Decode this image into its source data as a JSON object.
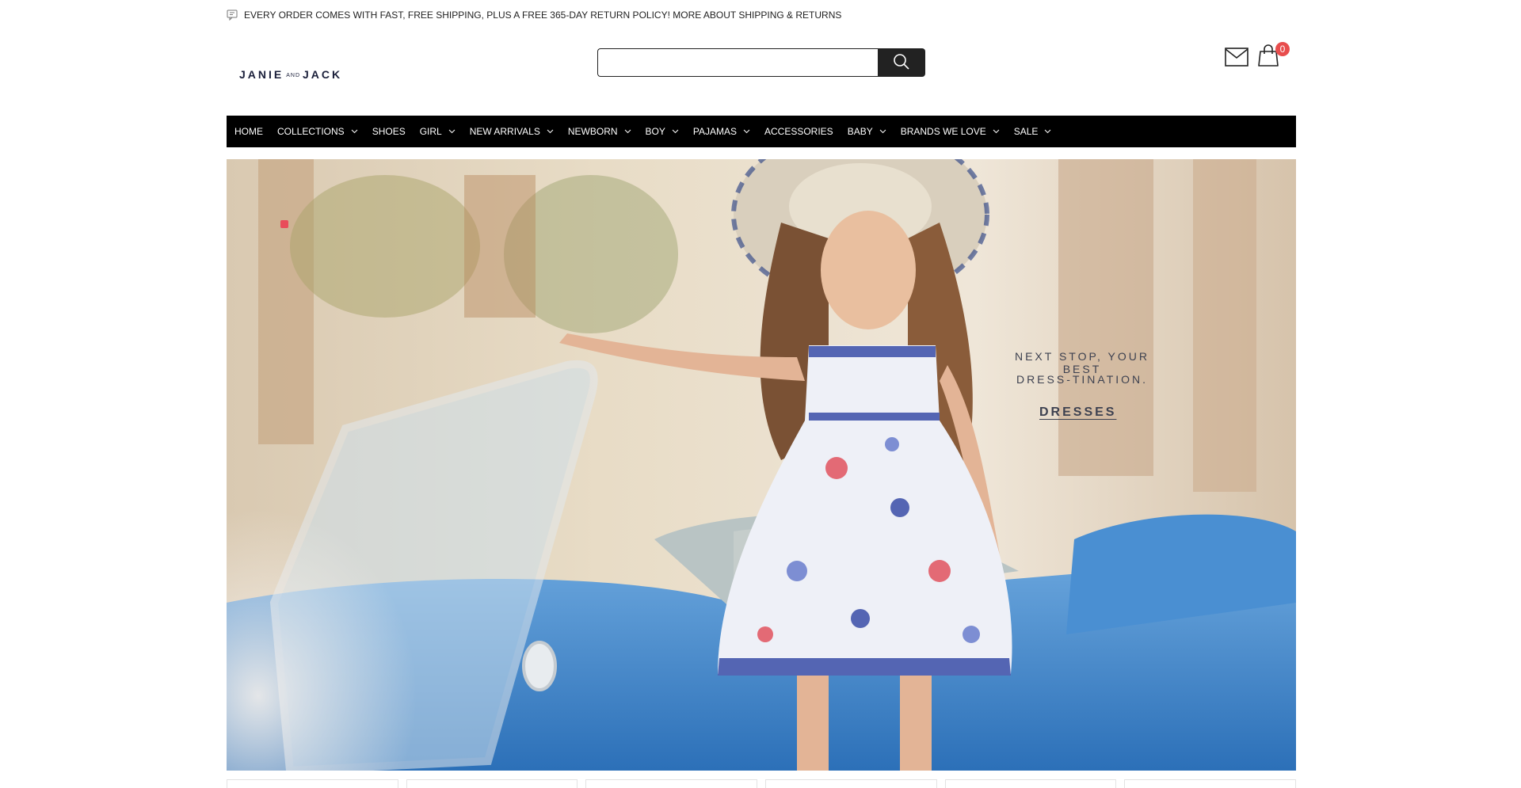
{
  "announcement": {
    "text": "EVERY ORDER COMES WITH FAST, FREE SHIPPING, PLUS A FREE 365-DAY RETURN POLICY! MORE ABOUT SHIPPING & RETURNS",
    "icon": "chat-bubble-icon"
  },
  "header": {
    "logo_left": "JANIE",
    "logo_middle": "AND",
    "logo_right": "JACK",
    "search_value": "",
    "search_placeholder": "",
    "cart_count": "0"
  },
  "nav": {
    "items": [
      {
        "label": "HOME",
        "has_dropdown": false
      },
      {
        "label": "COLLECTIONS",
        "has_dropdown": true
      },
      {
        "label": "SHOES",
        "has_dropdown": false
      },
      {
        "label": "GIRL",
        "has_dropdown": true
      },
      {
        "label": "NEW ARRIVALS",
        "has_dropdown": true
      },
      {
        "label": "NEWBORN",
        "has_dropdown": true
      },
      {
        "label": "BOY",
        "has_dropdown": true
      },
      {
        "label": "PAJAMAS",
        "has_dropdown": true
      },
      {
        "label": "ACCESSORIES",
        "has_dropdown": false
      },
      {
        "label": "BABY",
        "has_dropdown": true
      },
      {
        "label": "BRANDS WE LOVE",
        "has_dropdown": true
      },
      {
        "label": "SALE",
        "has_dropdown": true
      }
    ]
  },
  "hero": {
    "tagline_1": "NEXT STOP, YOUR BEST",
    "tagline_2": "DRESS-TINATION.",
    "cta": "DRESSES"
  },
  "colors": {
    "nav_bg": "#000000",
    "badge": "#e84d4d",
    "car_blue": "#3b86cf",
    "logo": "#1a1f3a"
  }
}
